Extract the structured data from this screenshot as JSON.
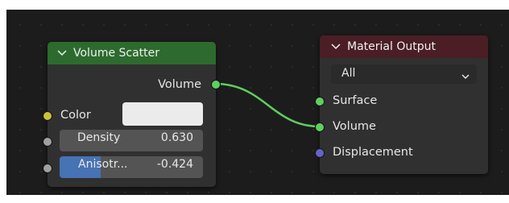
{
  "colors": {
    "scatter_header": "#2c6b2d",
    "output_header": "#4a1e24",
    "shader_socket": "#5fcf5f",
    "color_socket": "#c9c33a",
    "float_socket": "#a0a0a0",
    "vector_socket": "#6363c8",
    "slider_fill": "#4772b3",
    "link": "#5fcf5f"
  },
  "volume_scatter": {
    "collapse_icon": "chevron-down",
    "title": "Volume Scatter",
    "output_volume": "Volume",
    "color_label": "Color",
    "density_label": "Density",
    "density_value": "0.630",
    "anisotropy_label": "Anisotr...",
    "anisotropy_value": "-0.424",
    "anisotropy_fraction": 0.288
  },
  "material_output": {
    "collapse_icon": "chevron-down",
    "title": "Material Output",
    "target_selected": "All",
    "input_surface": "Surface",
    "input_volume": "Volume",
    "input_displacement": "Displacement"
  }
}
